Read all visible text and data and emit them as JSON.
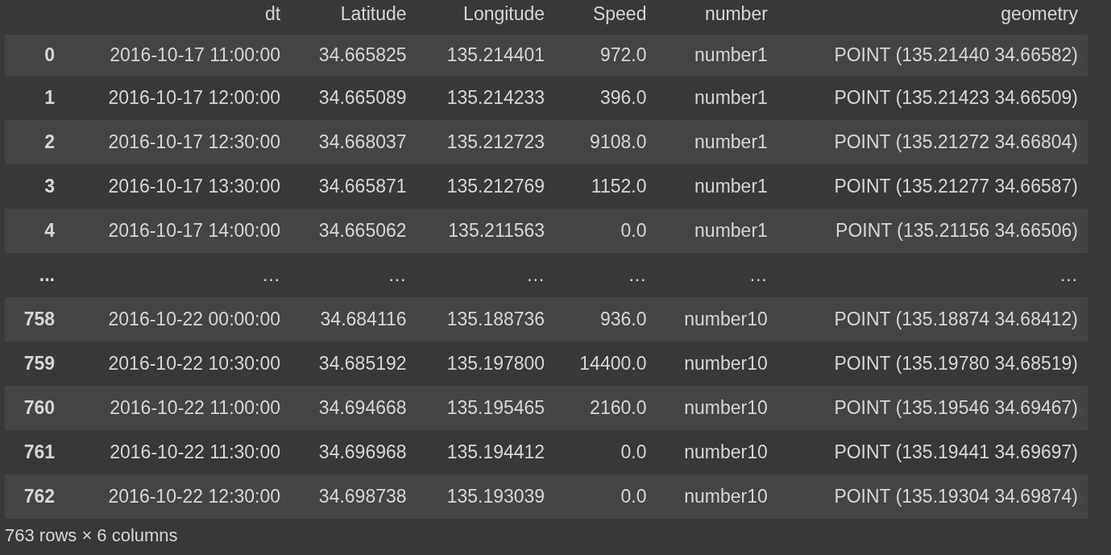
{
  "table": {
    "columns": [
      "dt",
      "Latitude",
      "Longitude",
      "Speed",
      "number",
      "geometry"
    ],
    "rows": [
      {
        "index": "0",
        "cells": [
          "2016-10-17 11:00:00",
          "34.665825",
          "135.214401",
          "972.0",
          "number1",
          "POINT (135.21440 34.66582)"
        ]
      },
      {
        "index": "1",
        "cells": [
          "2016-10-17 12:00:00",
          "34.665089",
          "135.214233",
          "396.0",
          "number1",
          "POINT (135.21423 34.66509)"
        ]
      },
      {
        "index": "2",
        "cells": [
          "2016-10-17 12:30:00",
          "34.668037",
          "135.212723",
          "9108.0",
          "number1",
          "POINT (135.21272 34.66804)"
        ]
      },
      {
        "index": "3",
        "cells": [
          "2016-10-17 13:30:00",
          "34.665871",
          "135.212769",
          "1152.0",
          "number1",
          "POINT (135.21277 34.66587)"
        ]
      },
      {
        "index": "4",
        "cells": [
          "2016-10-17 14:00:00",
          "34.665062",
          "135.211563",
          "0.0",
          "number1",
          "POINT (135.21156 34.66506)"
        ]
      },
      {
        "index": "...",
        "cells": [
          "…",
          "…",
          "…",
          "…",
          "…",
          "…"
        ]
      },
      {
        "index": "758",
        "cells": [
          "2016-10-22 00:00:00",
          "34.684116",
          "135.188736",
          "936.0",
          "number10",
          "POINT (135.18874 34.68412)"
        ]
      },
      {
        "index": "759",
        "cells": [
          "2016-10-22 10:30:00",
          "34.685192",
          "135.197800",
          "14400.0",
          "number10",
          "POINT (135.19780 34.68519)"
        ]
      },
      {
        "index": "760",
        "cells": [
          "2016-10-22 11:00:00",
          "34.694668",
          "135.195465",
          "2160.0",
          "number10",
          "POINT (135.19546 34.69467)"
        ]
      },
      {
        "index": "761",
        "cells": [
          "2016-10-22 11:30:00",
          "34.696968",
          "135.194412",
          "0.0",
          "number10",
          "POINT (135.19441 34.69697)"
        ]
      },
      {
        "index": "762",
        "cells": [
          "2016-10-22 12:30:00",
          "34.698738",
          "135.193039",
          "0.0",
          "number10",
          "POINT (135.19304 34.69874)"
        ]
      }
    ]
  },
  "footer": "763 rows × 6 columns"
}
